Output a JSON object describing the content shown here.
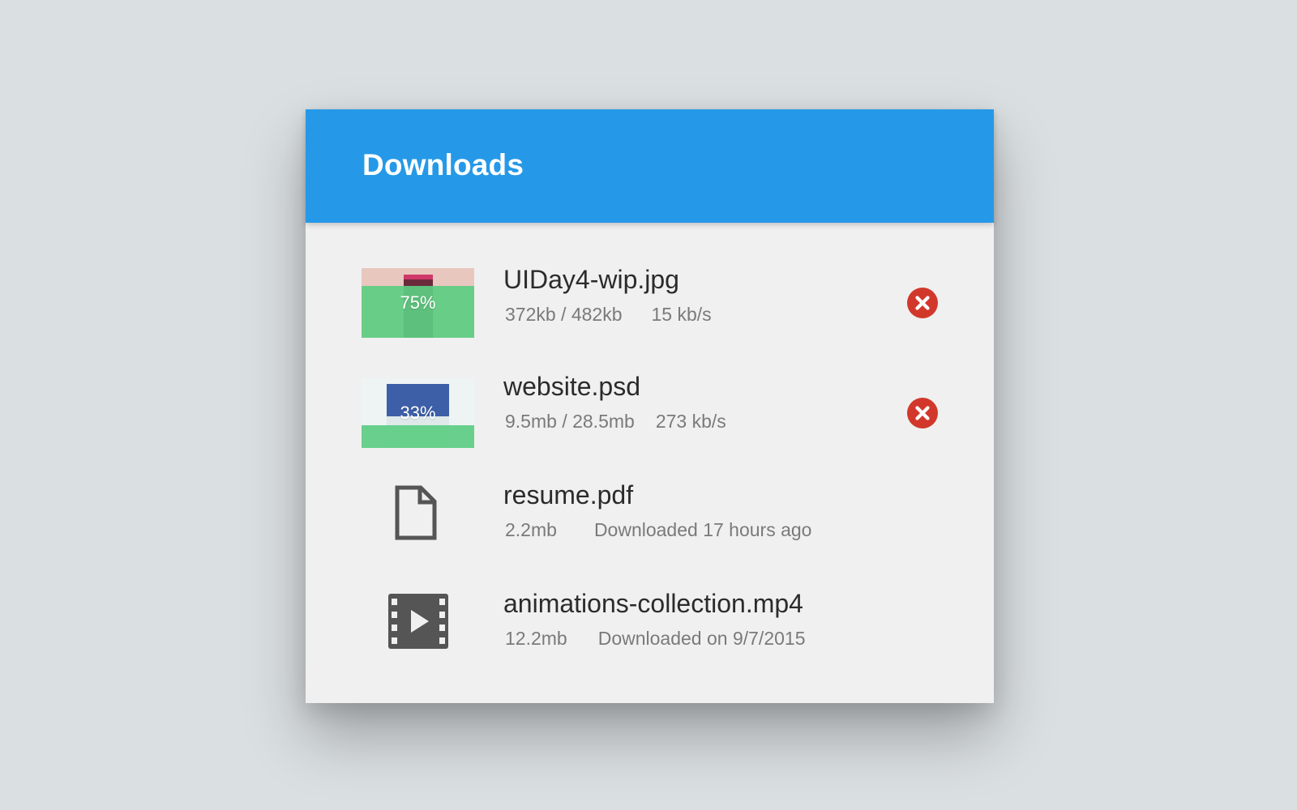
{
  "panel": {
    "title": "Downloads"
  },
  "colors": {
    "header": "#2599e8",
    "progress": "#5ccd82",
    "cancel": "#d1382b",
    "background": "#dadfe2"
  },
  "downloads": [
    {
      "name": "UIDay4-wip.jpg",
      "progress_label": "75%",
      "progress": 0.75,
      "size": "372kb / 482kb",
      "speed": "15 kb/s",
      "status": "in-progress",
      "icon": "image-thumbnail"
    },
    {
      "name": "website.psd",
      "progress_label": "33%",
      "progress": 0.33,
      "size": "9.5mb / 28.5mb",
      "speed": "273 kb/s",
      "status": "in-progress",
      "icon": "image-thumbnail"
    },
    {
      "name": "resume.pdf",
      "size": "2.2mb",
      "info": "Downloaded 17 hours ago",
      "status": "complete",
      "icon": "document-icon"
    },
    {
      "name": "animations-collection.mp4",
      "size": "12.2mb",
      "info": "Downloaded on 9/7/2015",
      "status": "complete",
      "icon": "video-icon"
    }
  ]
}
